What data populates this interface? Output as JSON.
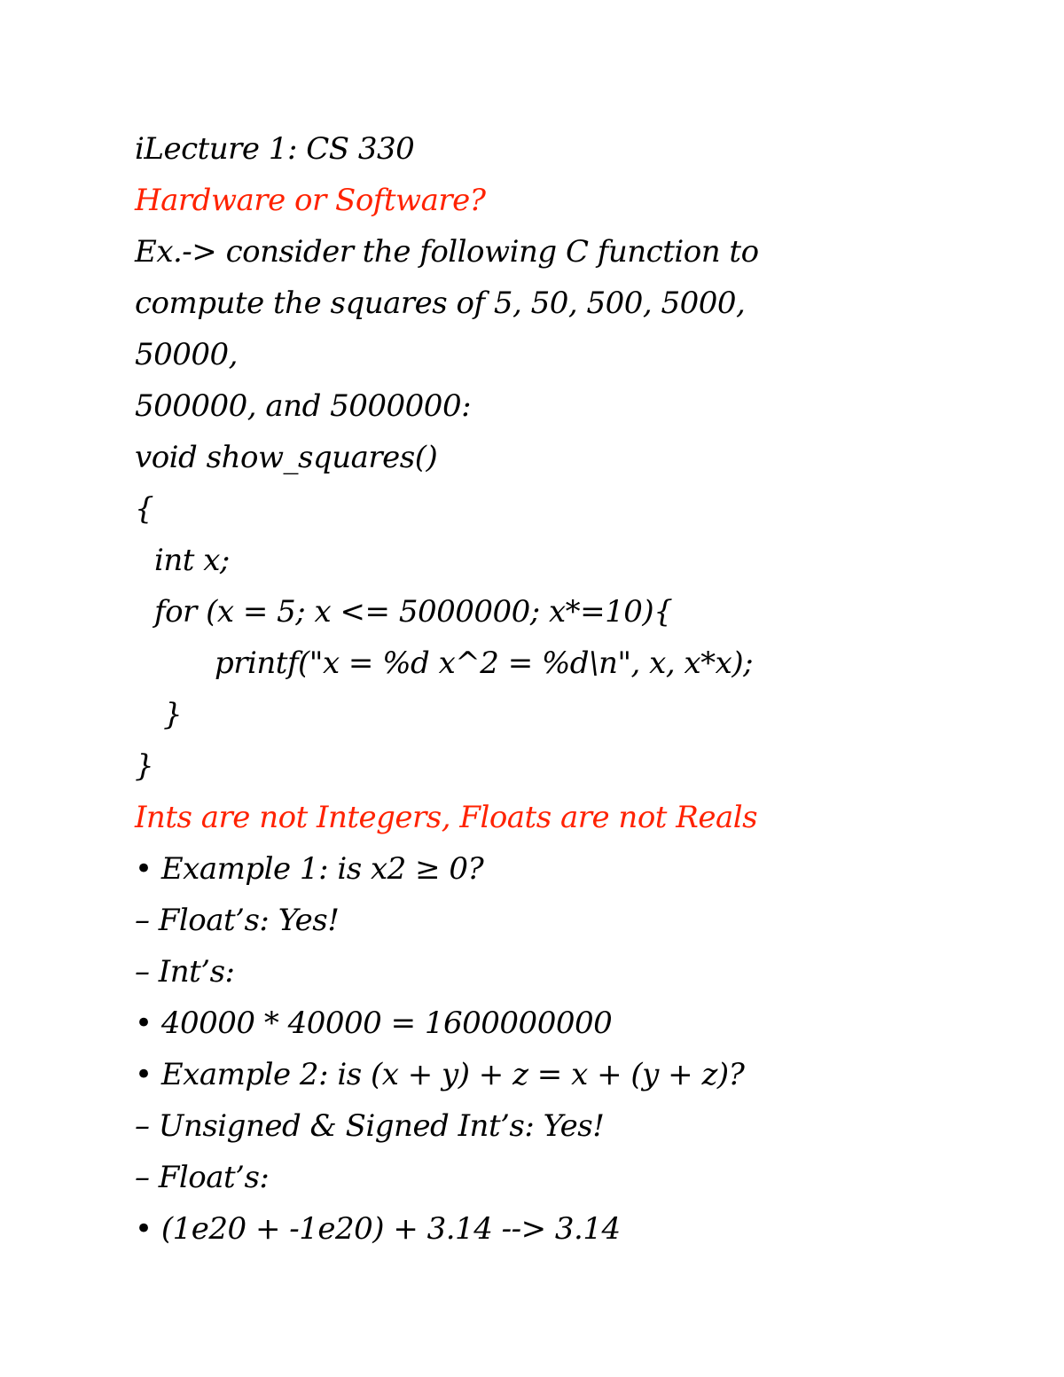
{
  "document": {
    "colors": {
      "text": "#000000",
      "heading": "#ff2200",
      "background": "#ffffff"
    },
    "title": "iLecture 1: CS 330",
    "section1": {
      "heading": "Hardware or Software?",
      "intro_lines": [
        "Ex.-> consider the following C function to",
        "compute the squares of 5, 50, 500, 5000,",
        "50000,",
        "500000, and 5000000:"
      ],
      "code_lines": [
        "void show_squares()",
        "{",
        "int x;",
        "for (x = 5; x <= 5000000; x*=10){",
        "printf(\"x = %d x^2 = %d\\n\", x, x*x);",
        "}",
        "}"
      ]
    },
    "section2": {
      "heading": "Ints are not Integers, Floats are not Reals",
      "lines": [
        "• Example 1: is x2 ≥ 0?",
        "– Float’s: Yes!",
        "– Int’s:",
        "• 40000 * 40000 = 1600000000",
        "• Example 2: is (x + y) + z = x + (y + z)?",
        "– Unsigned & Signed Int’s: Yes!",
        "– Float’s:",
        "• (1e20 + -1e20) + 3.14 --> 3.14"
      ]
    }
  }
}
